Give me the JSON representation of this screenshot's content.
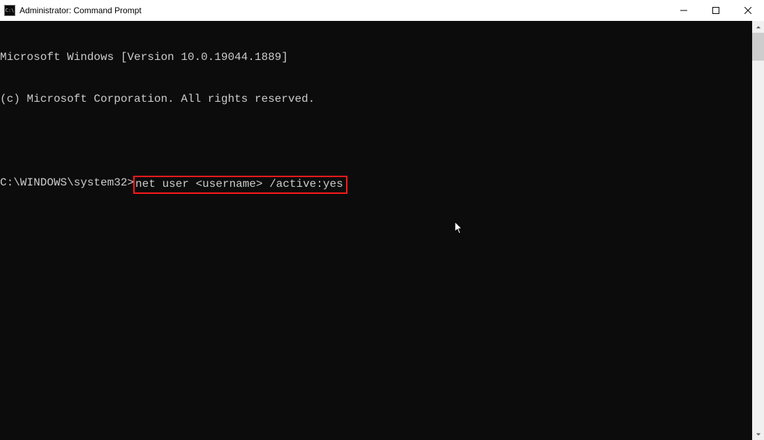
{
  "window": {
    "title": "Administrator: Command Prompt"
  },
  "terminal": {
    "line1": "Microsoft Windows [Version 10.0.19044.1889]",
    "line2": "(c) Microsoft Corporation. All rights reserved.",
    "blank": "",
    "prompt": "C:\\WINDOWS\\system32>",
    "command": "net user <username> /active:yes"
  }
}
